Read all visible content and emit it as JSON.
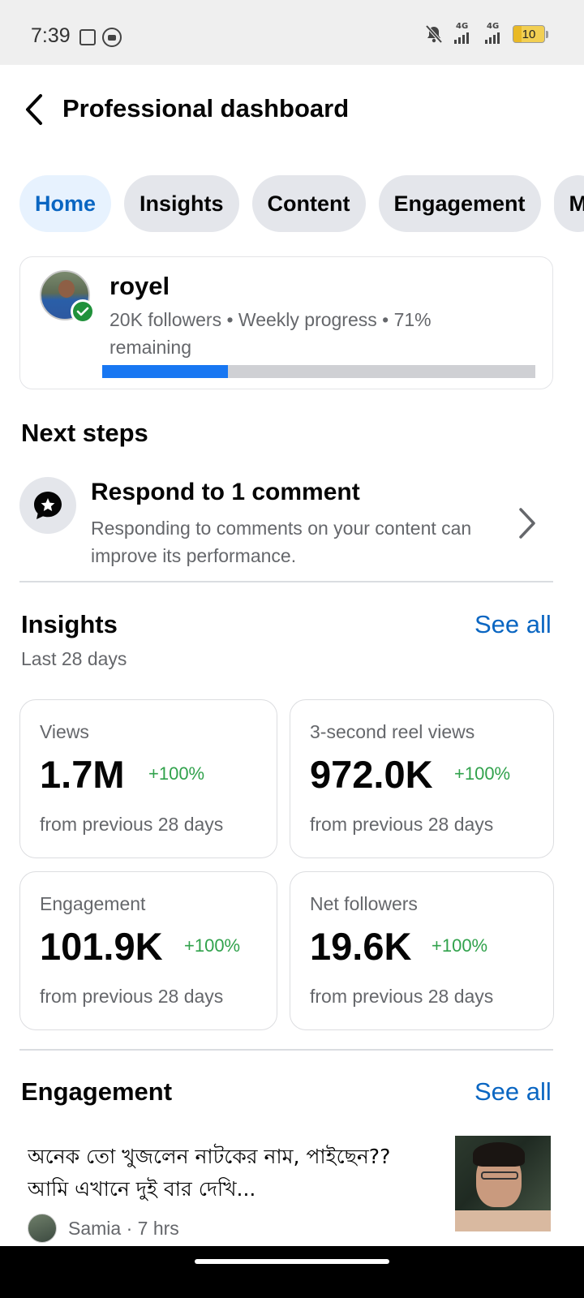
{
  "status_bar": {
    "time": "7:39",
    "net1": "4G",
    "net2": "4G",
    "battery": "10"
  },
  "header": {
    "title": "Professional dashboard"
  },
  "tabs": [
    "Home",
    "Insights",
    "Content",
    "Engagement",
    "M"
  ],
  "profile": {
    "name": "royel",
    "subtitle": "20K followers • Weekly progress • 71% remaining",
    "progress_fraction": 0.29
  },
  "next_steps": {
    "title": "Next steps",
    "item": {
      "title": "Respond to 1 comment",
      "description": "Responding to comments on your content can improve its performance."
    }
  },
  "insights": {
    "title": "Insights",
    "see_all": "See all",
    "period": "Last 28 days",
    "metrics": [
      {
        "label": "Views",
        "value": "1.7M",
        "change": "+100%",
        "note": "from previous 28 days"
      },
      {
        "label": "3-second reel views",
        "value": "972.0K",
        "change": "+100%",
        "note": "from previous 28 days"
      },
      {
        "label": "Engagement",
        "value": "101.9K",
        "change": "+100%",
        "note": "from previous 28 days"
      },
      {
        "label": "Net followers",
        "value": "19.6K",
        "change": "+100%",
        "note": "from previous 28 days"
      }
    ]
  },
  "engagement": {
    "title": "Engagement",
    "see_all": "See all",
    "post": {
      "text": "অনেক তো খুজলেন নাটকের নাম, পাইছেন?? আমি এখানে দুই বার দেখি...",
      "author": "Samia · 7 hrs"
    }
  },
  "colors": {
    "accent": "#0a66c2",
    "progress": "#1877f2",
    "positive": "#31a24c",
    "verified": "#20913b"
  }
}
